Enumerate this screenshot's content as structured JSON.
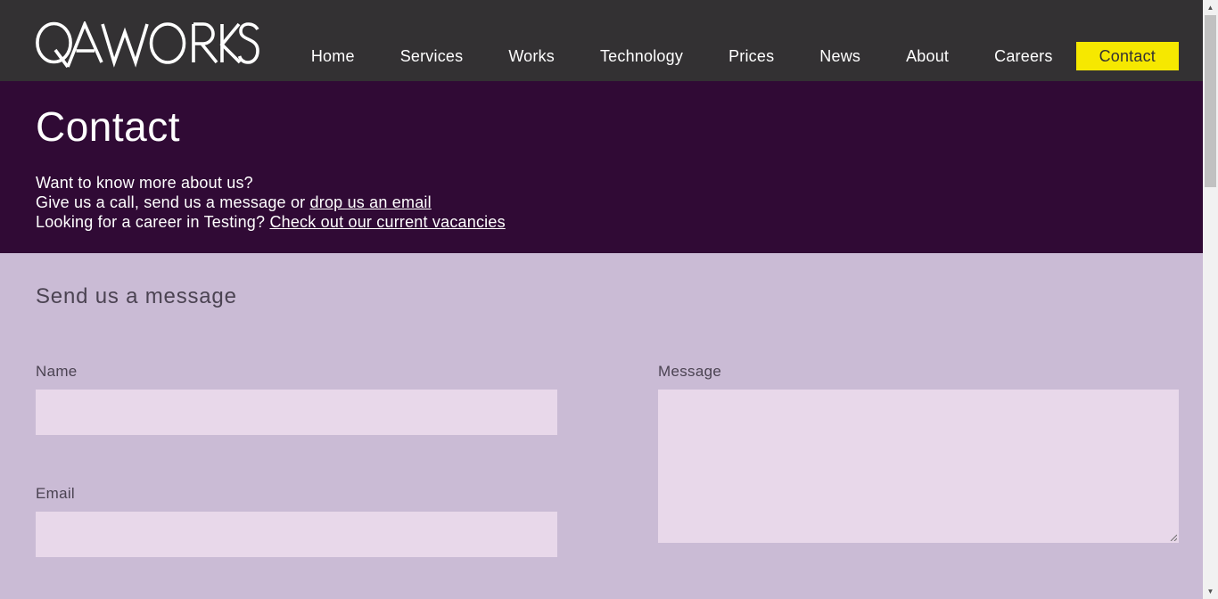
{
  "brand": {
    "logo_text": "QAWORKS"
  },
  "nav": {
    "items": [
      {
        "label": "Home"
      },
      {
        "label": "Services"
      },
      {
        "label": "Works"
      },
      {
        "label": "Technology"
      },
      {
        "label": "Prices"
      },
      {
        "label": "News"
      },
      {
        "label": "About"
      },
      {
        "label": "Careers"
      },
      {
        "label": "Contact",
        "active": true
      }
    ]
  },
  "hero": {
    "title": "Contact",
    "line1": "Want to know more about us?",
    "line2_prefix": "Give us a call, send us a message or ",
    "line2_link": "drop us an email",
    "line3_prefix": "Looking for a career in Testing? ",
    "line3_link": "Check out our current vacancies"
  },
  "form": {
    "title": "Send us a message",
    "name_label": "Name",
    "name_value": "",
    "email_label": "Email",
    "email_value": "",
    "message_label": "Message",
    "message_value": ""
  },
  "colors": {
    "header_bg": "#333133",
    "hero_bg": "#300a35",
    "form_bg": "#cabbd5",
    "field_bg": "#e8d8ea",
    "accent": "#f6e800"
  },
  "icons": {
    "scroll_up": "triangle-up-icon",
    "scroll_down": "triangle-down-icon",
    "resize": "resize-grip-icon"
  }
}
